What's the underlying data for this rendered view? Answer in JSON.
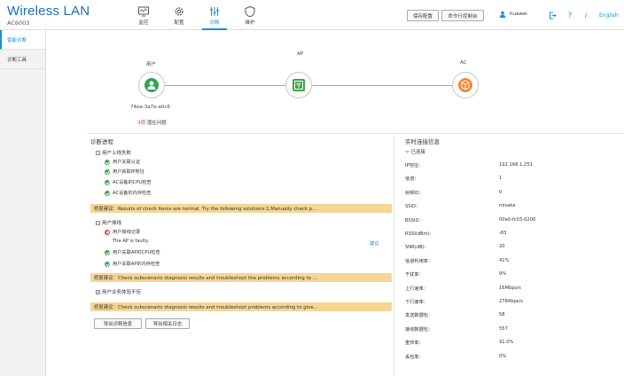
{
  "header": {
    "brand_title": "Wireless LAN",
    "brand_model": "AC6003",
    "nav": [
      {
        "label": "监控",
        "icon": "monitor-icon"
      },
      {
        "label": "配置",
        "icon": "gear-icon"
      },
      {
        "label": "诊断",
        "icon": "sliders-icon"
      },
      {
        "label": "维护",
        "icon": "shield-icon"
      }
    ],
    "active_nav": "诊断",
    "save_config": "保存配置",
    "cli": "命令行控制台",
    "username": "huawei",
    "help": "?",
    "info": "i",
    "language": "English",
    "accent_color": "#1a8fd8"
  },
  "sidebar": {
    "items": [
      {
        "label": "智能诊断",
        "active": true
      },
      {
        "label": "诊断工具",
        "active": false
      }
    ]
  },
  "topology": {
    "user_label": "用户",
    "ap_label": "AP",
    "ac_label": "AC",
    "mac": "74ea-3a7e-a0c6",
    "issue_count": "3项",
    "issue_text": "潜在问题",
    "link_color": "#7dc47d"
  },
  "diagnosis": {
    "title": "诊断进程",
    "groups": [
      {
        "label": "用户上线失败",
        "checks": [
          {
            "status": "ok",
            "text": "用户关联认证"
          },
          {
            "status": "ok",
            "text": "用户获取IP地址"
          },
          {
            "status": "ok",
            "text": "AC设备的CPU检查"
          },
          {
            "status": "ok",
            "text": "AC设备的内存检查"
          }
        ],
        "suggestion": "修复建议：Results of check items are normal. Try the following solutions:1.Manually check p..."
      },
      {
        "label": "用户掉线",
        "checks": [
          {
            "status": "error",
            "text": "用户掉线记录"
          },
          {
            "status": "ok",
            "text": "用户关联AP的CPU检查"
          },
          {
            "status": "ok",
            "text": "用户关联AP的内存检查"
          }
        ],
        "fault": "The AP is faulty.",
        "detail_link": "建议",
        "suggestion": "修复建议：Check subscenario diagnosis results and troubleshoot the problems according to ..."
      },
      {
        "label": "用户业务体验不佳",
        "checks": [],
        "suggestion": "修复建议：Check subscenario diagnosis results and troubleshoot problems according to give..."
      }
    ],
    "export_diag": "导出诊断信息",
    "export_log": "导出相关日志"
  },
  "realtime": {
    "title": "实时连接信息",
    "status": "已连接",
    "rows": [
      {
        "key": "IP地址：",
        "value": "192.168.1.251"
      },
      {
        "key": "信道：",
        "value": "1"
      },
      {
        "key": "射频ID：",
        "value": "0"
      },
      {
        "key": "SSID：",
        "value": "misaka"
      },
      {
        "key": "BSSID：",
        "value": "00e0-fc03-0200"
      },
      {
        "key": "RSSI(dBm)：",
        "value": "-83"
      },
      {
        "key": "SNR(dB)：",
        "value": "20"
      },
      {
        "key": "信道利用率：",
        "value": "41%"
      },
      {
        "key": "干扰率：",
        "value": "9%"
      },
      {
        "key": "上行速率：",
        "value": "16Mbps/s"
      },
      {
        "key": "下行速率：",
        "value": "2784bps/s"
      },
      {
        "key": "发送数据包：",
        "value": "58"
      },
      {
        "key": "接收数据包：",
        "value": "557"
      },
      {
        "key": "重传率：",
        "value": "91.0%"
      },
      {
        "key": "丢包率：",
        "value": "0%"
      }
    ]
  }
}
